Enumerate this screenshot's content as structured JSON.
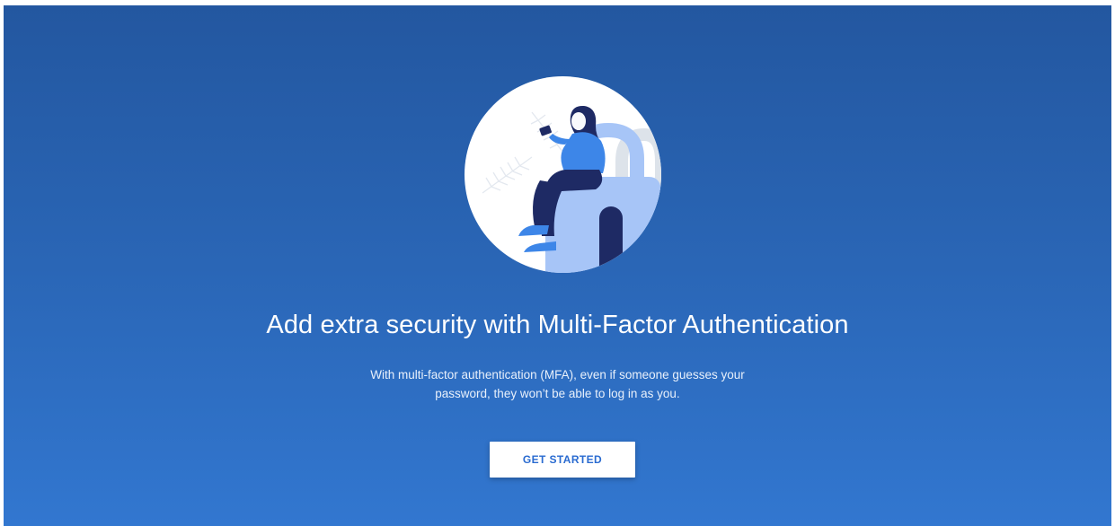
{
  "hero": {
    "title": "Add extra security with Multi-Factor Authentication",
    "description_line1": "With multi-factor authentication (MFA), even if someone guesses your",
    "description_line2": "password, they won’t be able to log in as you.",
    "cta_label": "GET STARTED"
  },
  "illustration": {
    "icon": "person-on-padlock-illustration"
  },
  "colors": {
    "background_top": "#2357a0",
    "background_bottom": "#3277d0",
    "button_text": "#2a6bd0",
    "illustration_navy": "#1e2a64",
    "illustration_blue": "#3d86e8",
    "illustration_light_blue": "#a7c5f7"
  }
}
